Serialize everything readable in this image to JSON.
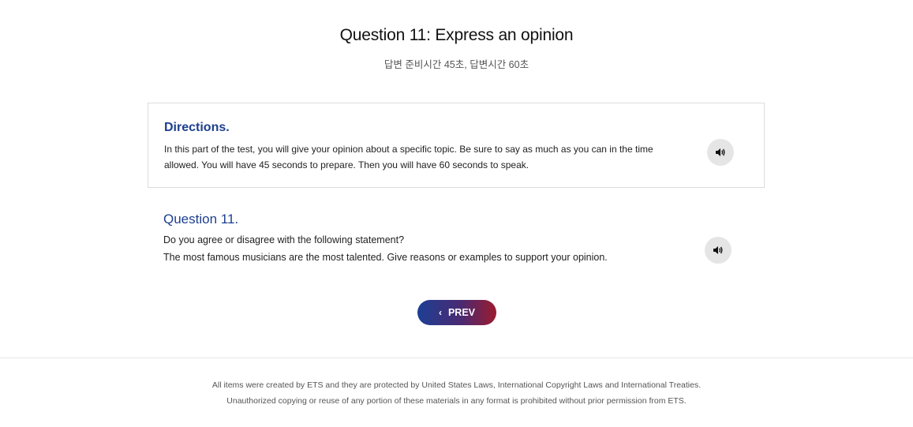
{
  "header": {
    "title": "Question 11: Express an opinion",
    "subtitle": "답변 준비시간 45초, 답변시간 60초"
  },
  "directions": {
    "heading": "Directions.",
    "text": "In this part of the test, you will give your opinion about a specific topic. Be sure to say as much as you can in the time allowed. You will have 45 seconds to prepare. Then you will have 60 seconds to speak.",
    "audio_icon": "speaker-icon"
  },
  "question": {
    "heading": "Question 11.",
    "line1": "Do you agree or disagree with the following statement?",
    "line2": "The most famous musicians are the most talented. Give reasons or examples to support your opinion.",
    "audio_icon": "speaker-icon"
  },
  "navigation": {
    "prev_label": "PREV",
    "prev_icon": "chevron-left-icon",
    "gradient_start": "#1d3f94",
    "gradient_end": "#9b1b2e"
  },
  "footer": {
    "line1": "All items were created by ETS and they are protected by United States Laws, International Copyright Laws and International Treaties.",
    "line2": "Unauthorized copying or reuse of any portion of these materials in any format is prohibited without prior permission from ETS."
  },
  "colors": {
    "accent_blue": "#1d3f8f",
    "audio_button_bg": "#e5e5e5"
  }
}
